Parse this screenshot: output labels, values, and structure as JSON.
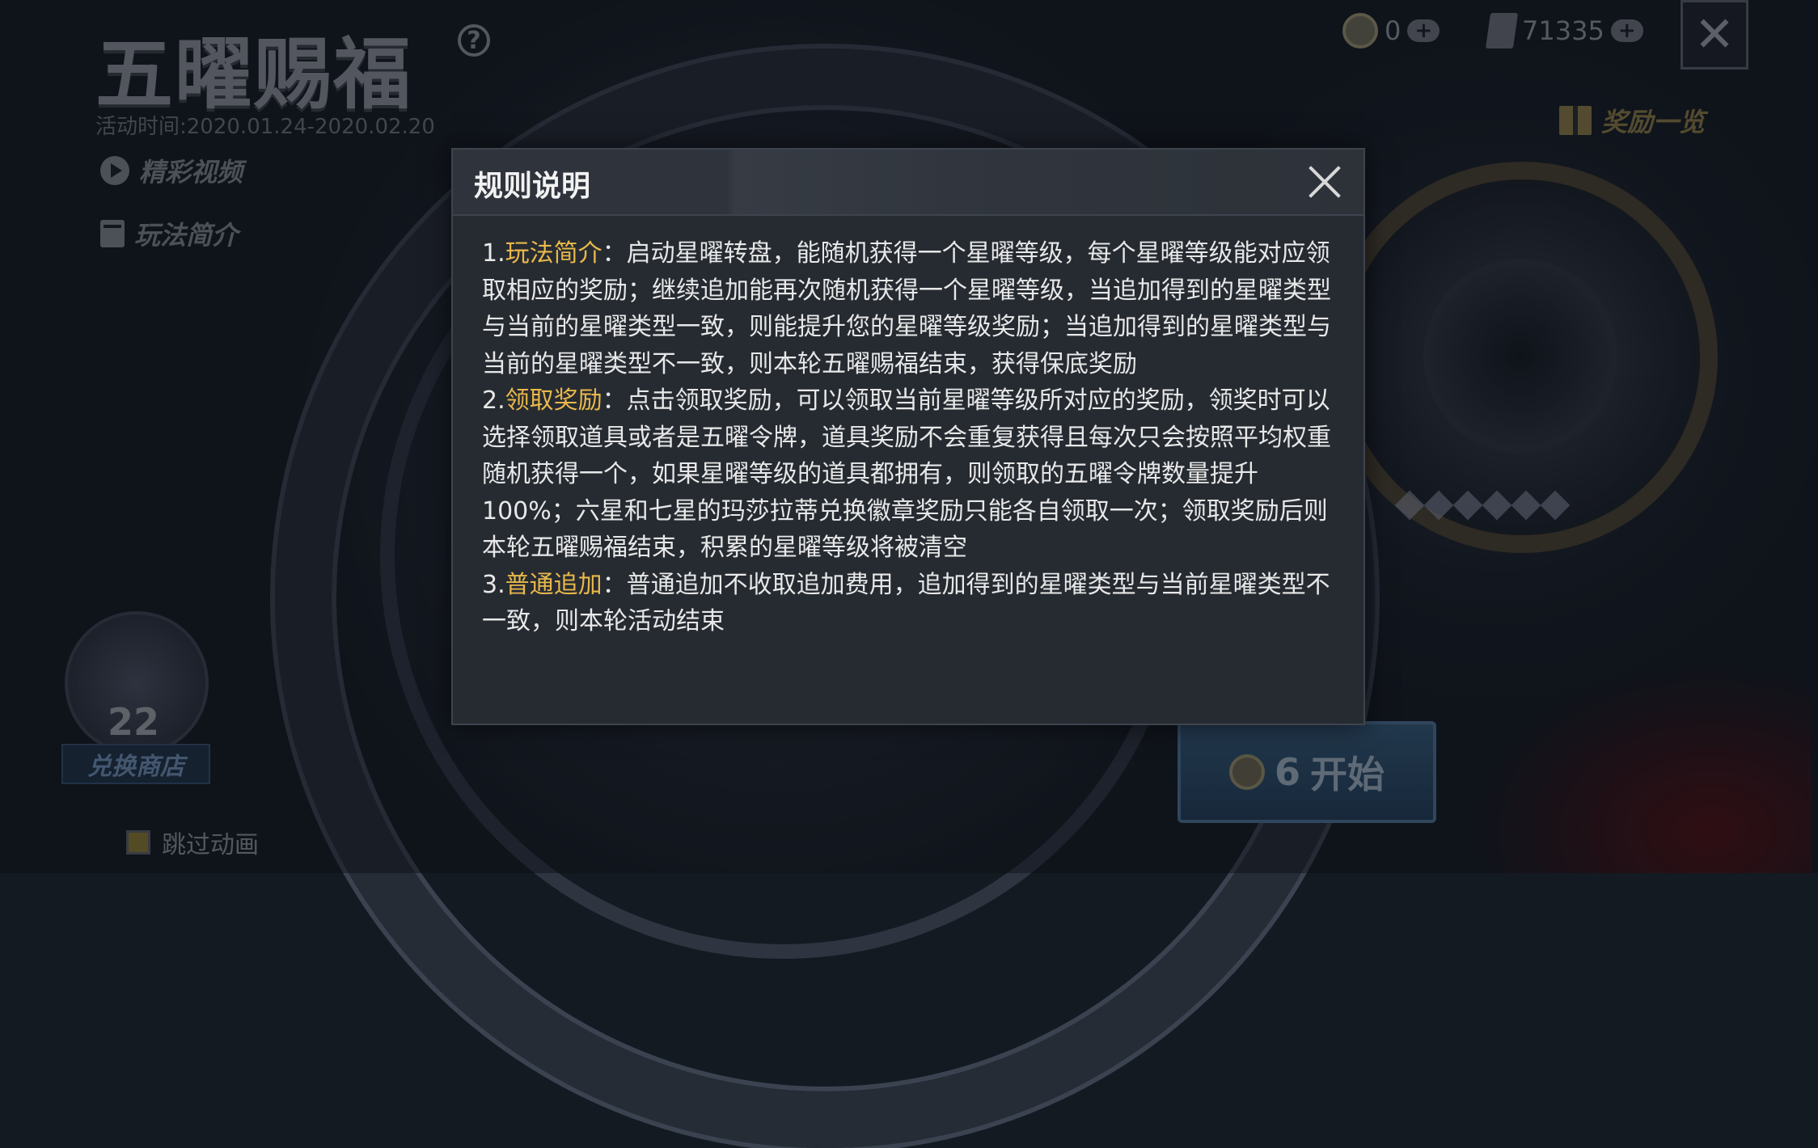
{
  "header": {
    "title": "五曜赐福",
    "activity_time": "活动时间:2020.01.24-2020.02.20",
    "help_icon": "question-icon"
  },
  "side_links": {
    "video": "精彩视频",
    "intro": "玩法简介"
  },
  "currency": {
    "coin_value": "0",
    "ticket_value": "71335",
    "plus": "+"
  },
  "close_glyph": "✕",
  "reward_list": "奖励一览",
  "shop": {
    "count": "22",
    "label": "兑换商店"
  },
  "skip_animation": "跳过动画",
  "start_button": {
    "cost": "6",
    "label": "开始"
  },
  "modal": {
    "title": "规则说明",
    "rules": [
      {
        "num": "1.",
        "keyword": "玩法简介",
        "text": "：启动星曜转盘，能随机获得一个星曜等级，每个星曜等级能对应领取相应的奖励；继续追加能再次随机获得一个星曜等级，当追加得到的星曜类型与当前的星曜类型一致，则能提升您的星曜等级奖励；当追加得到的星曜类型与当前的星曜类型不一致，则本轮五曜赐福结束，获得保底奖励"
      },
      {
        "num": "2.",
        "keyword": "领取奖励",
        "text": "：点击领取奖励，可以领取当前星曜等级所对应的奖励，领奖时可以选择领取道具或者是五曜令牌，道具奖励不会重复获得且每次只会按照平均权重随机获得一个，如果星曜等级的道具都拥有，则领取的五曜令牌数量提升100%；六星和七星的玛莎拉蒂兑换徽章奖励只能各自领取一次；领取奖励后则本轮五曜赐福结束，积累的星曜等级将被清空"
      },
      {
        "num": "3.",
        "keyword": "普通追加",
        "text": "：普通追加不收取追加费用，追加得到的星曜类型与当前星曜类型不一致，则本轮活动结束"
      }
    ]
  },
  "colors": {
    "keyword": "#e9b84a",
    "modal_bg": "#262b32",
    "text": "#e8e8e8"
  }
}
